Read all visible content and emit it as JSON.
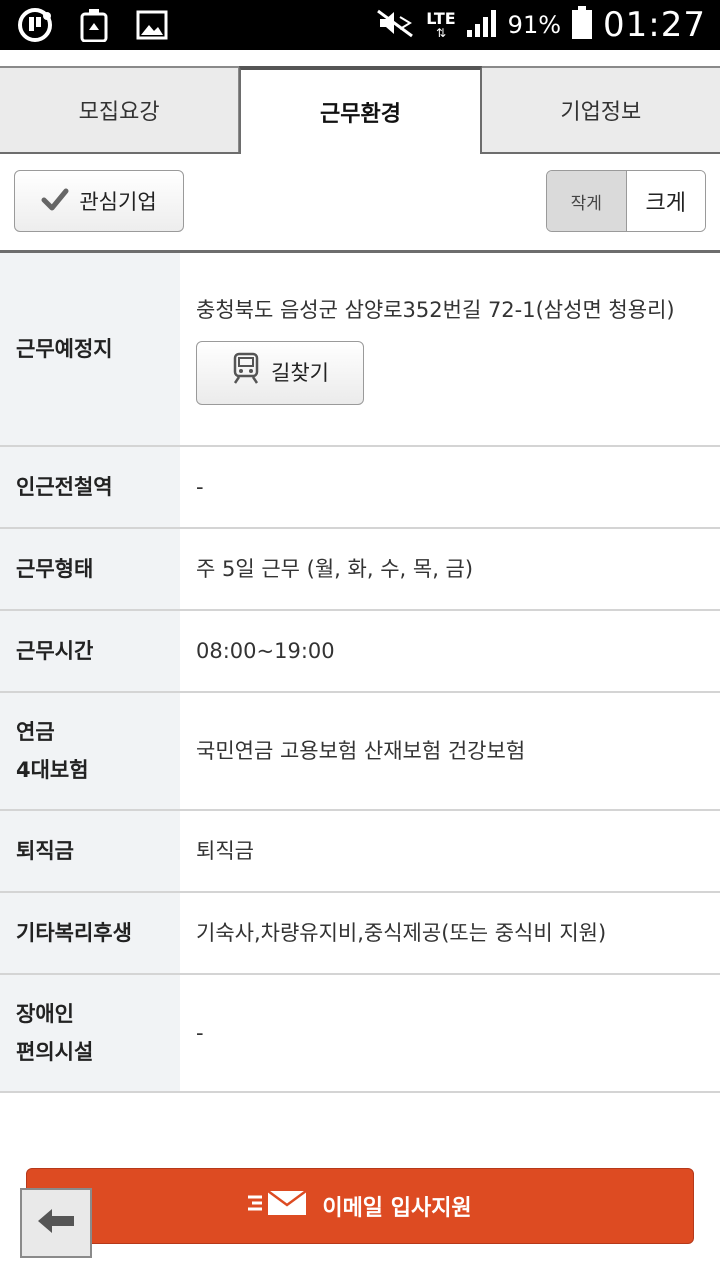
{
  "status_bar": {
    "left_icons": [
      "uplus-icon",
      "recycle-icon",
      "image-icon"
    ],
    "network": "LTE",
    "battery_percent": "91%",
    "time": "01:27"
  },
  "tabs": [
    {
      "label": "모집요강",
      "active": false
    },
    {
      "label": "근무환경",
      "active": true
    },
    {
      "label": "기업정보",
      "active": false
    }
  ],
  "toolbar": {
    "favorite_label": "관심기업",
    "size_small_label": "작게",
    "size_large_label": "크게"
  },
  "info": {
    "location": {
      "label": "근무예정지",
      "value": "충청북도 음성군 삼양로352번길 72-1(삼성면 청용리)",
      "route_label": "길찾기"
    },
    "subway": {
      "label": "인근전철역",
      "value": "-"
    },
    "work_type": {
      "label": "근무형태",
      "value": "주 5일 근무 (월, 화, 수, 목, 금)"
    },
    "work_hours": {
      "label": "근무시간",
      "value": "08:00~19:00"
    },
    "insurance": {
      "label_line1": "연금",
      "label_line2": "4대보험",
      "value": "국민연금 고용보험 산재보험 건강보험"
    },
    "severance": {
      "label": "퇴직금",
      "value": "퇴직금"
    },
    "welfare": {
      "label": "기타복리후생",
      "value": "기숙사,차량유지비,중식제공(또는 중식비 지원)"
    },
    "disability": {
      "label_line1": "장애인",
      "label_line2": "편의시설",
      "value": "-"
    }
  },
  "bottom": {
    "apply_label": "이메일 입사지원"
  },
  "colors": {
    "apply_bg": "#dd4b22",
    "label_bg": "#f1f3f5"
  }
}
